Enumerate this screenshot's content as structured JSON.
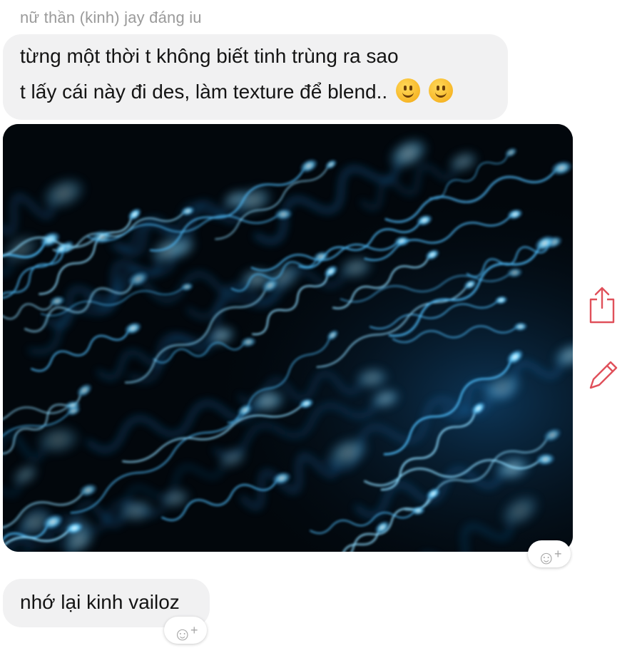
{
  "sender": {
    "name": "nữ thần (kinh) jay đáng iu"
  },
  "messages": [
    {
      "lines": [
        "từng một thời t không biết tinh trùng ra sao",
        "t lấy cái này đi des, làm texture để blend.."
      ],
      "emojis": [
        "slightly-smiling-face",
        "slightly-smiling-face"
      ]
    },
    {
      "type": "image",
      "description_icon": "photo"
    },
    {
      "lines": [
        "nhớ lại kinh vailoz"
      ]
    }
  ],
  "reactions": {
    "glyph": "☺",
    "plus": "+"
  },
  "actions": {
    "share_icon": "share-icon",
    "edit_icon": "pencil-icon",
    "accent": "#e0505a"
  },
  "colors": {
    "bubble": "#f1f1f2",
    "sender_name": "#9a9a9a",
    "photo_bg": "#02070c",
    "photo_glow": "#3fb8ff"
  }
}
